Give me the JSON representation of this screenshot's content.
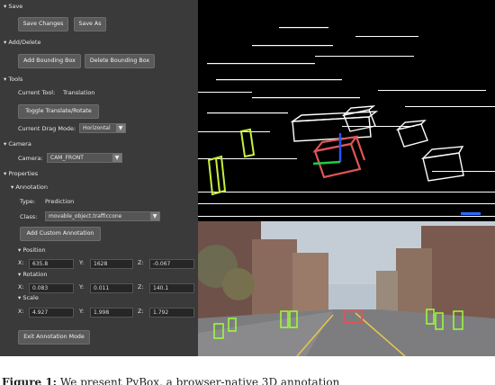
{
  "save": {
    "header": "▾ Save",
    "save_changes": "Save Changes",
    "save_as": "Save As"
  },
  "add_delete": {
    "header": "▾ Add/Delete",
    "add_box": "Add Bounding Box",
    "delete_box": "Delete Bounding Box"
  },
  "tools": {
    "header": "▾ Tools",
    "current_tool_label": "Current Tool:",
    "current_tool_value": "Translation",
    "toggle_button": "Toggle Translate/Rotate",
    "drag_mode_label": "Current Drag Mode:",
    "drag_mode_value": "Horizontal"
  },
  "camera": {
    "header": "▾ Camera",
    "label": "Camera:",
    "value": "CAM_FRONT"
  },
  "properties": {
    "header": "▾ Properties",
    "annotation_header": "▾ Annotation",
    "type_label": "Type:",
    "type_value": "Prediction",
    "class_label": "Class:",
    "class_value": "movable_object.trafficcone",
    "add_custom": "Add Custom Annotation",
    "position_header": "▾ Position",
    "position": {
      "x": "635.8",
      "y": "1628",
      "z": "-0.067"
    },
    "rotation_header": "▾ Rotation",
    "rotation": {
      "x": "0.083",
      "y": "0.011",
      "z": "140.1"
    },
    "scale_header": "▾ Scale",
    "scale": {
      "x": "4.927",
      "y": "1.998",
      "z": "1.792"
    },
    "x_label": "X:",
    "y_label": "Y:",
    "z_label": "Z:",
    "exit_button": "Exit Annotation Mode"
  },
  "caption": {
    "prefix": "Figure 1:",
    "text": " We present PyBox, a browser-native 3D annotation"
  },
  "colors": {
    "panel_bg": "#3a3a3a",
    "box_white": "#ffffff",
    "box_selected": "#e05555",
    "box_green": "#c8f03c",
    "axis_blue": "#2255ff",
    "axis_green": "#22cc44"
  }
}
